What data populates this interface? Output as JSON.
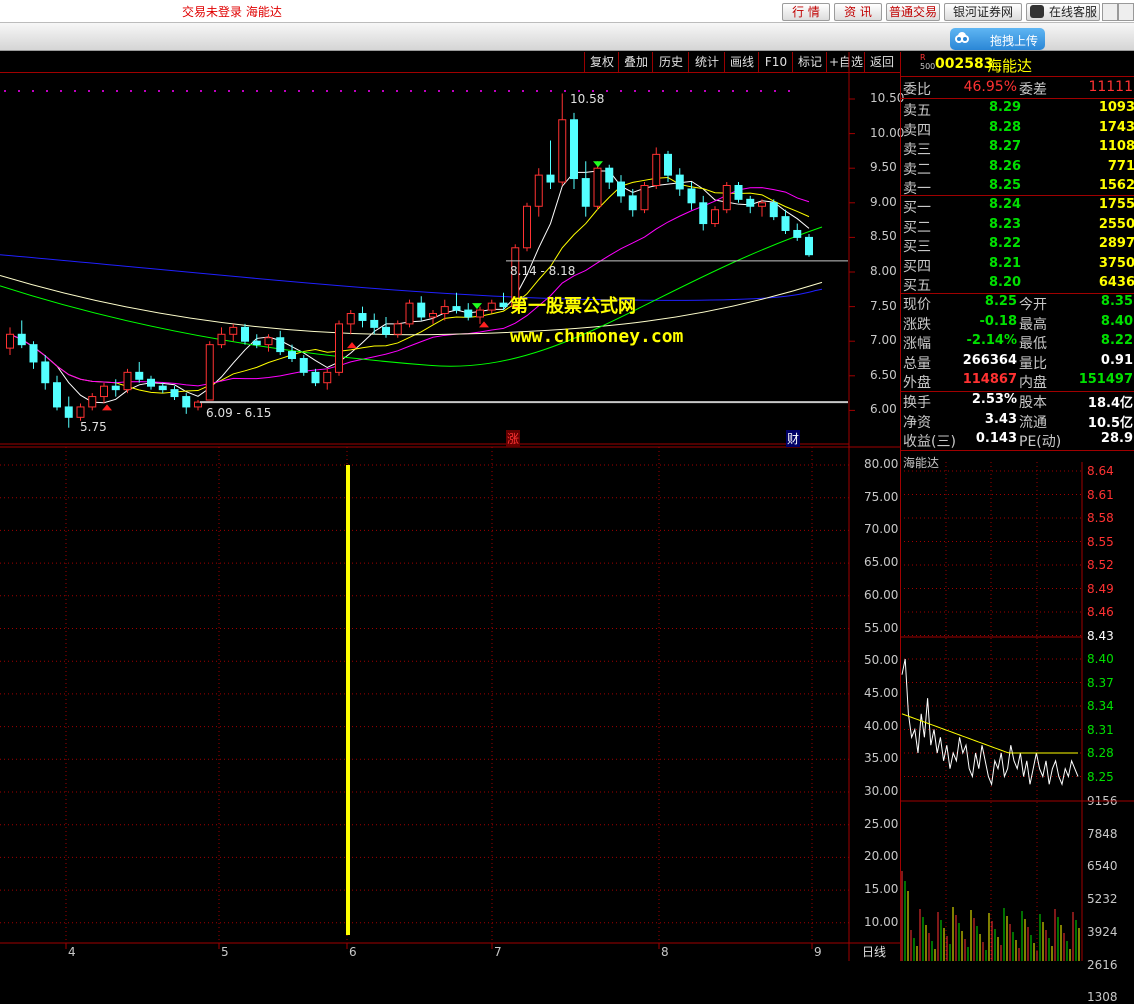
{
  "topbar": {
    "status": "交易未登录  海能达",
    "buttons": [
      "行 情",
      "资 讯",
      "普通交易",
      "银河证券网",
      "在线客服"
    ]
  },
  "toolbar": {
    "upload_label": "拖拽上传"
  },
  "menu": [
    "复权",
    "叠加",
    "历史",
    "统计",
    "画线",
    "F10",
    "标记",
    "+自选",
    "返回"
  ],
  "kline": {
    "price_axis": [
      "10.50",
      "10.00",
      "9.50",
      "9.00",
      "8.50",
      "8.00",
      "7.50",
      "7.00",
      "6.50",
      "6.00"
    ],
    "annotations": {
      "high": "10.58",
      "low": "5.75",
      "gap1": "6.09 - 6.15",
      "gap2": "8.14 - 8.18",
      "zhang": "涨",
      "cai": "财"
    }
  },
  "indicator": {
    "axis": [
      "80.00",
      "75.00",
      "70.00",
      "65.00",
      "60.00",
      "55.00",
      "50.00",
      "45.00",
      "40.00",
      "35.00",
      "30.00",
      "25.00",
      "20.00",
      "15.00",
      "10.00"
    ]
  },
  "x_axis": {
    "ticks": [
      "4",
      "5",
      "6",
      "7",
      "8",
      "9"
    ],
    "period": "日线"
  },
  "watermark": {
    "cn": "第一股票公式网",
    "url": "www.chnmoney.com"
  },
  "quote": {
    "r_badge": "R",
    "r_badge_sub": "500",
    "code": "002583",
    "name": "海能达",
    "weibi_label": "委比",
    "weibi": "46.95%",
    "weicha_label": "委差",
    "weicha": "11111",
    "asks": [
      {
        "label": "卖五",
        "price": "8.29",
        "vol": "1093"
      },
      {
        "label": "卖四",
        "price": "8.28",
        "vol": "1743"
      },
      {
        "label": "卖三",
        "price": "8.27",
        "vol": "1108"
      },
      {
        "label": "卖二",
        "price": "8.26",
        "vol": "771"
      },
      {
        "label": "卖一",
        "price": "8.25",
        "vol": "1562"
      }
    ],
    "bids": [
      {
        "label": "买一",
        "price": "8.24",
        "vol": "1755"
      },
      {
        "label": "买二",
        "price": "8.23",
        "vol": "2550"
      },
      {
        "label": "买三",
        "price": "8.22",
        "vol": "2897"
      },
      {
        "label": "买四",
        "price": "8.21",
        "vol": "3750"
      },
      {
        "label": "买五",
        "price": "8.20",
        "vol": "6436"
      }
    ],
    "stats": [
      {
        "l1": "现价",
        "v1": "8.25",
        "l2": "今开",
        "v2": "8.35"
      },
      {
        "l1": "涨跌",
        "v1": "-0.18",
        "l2": "最高",
        "v2": "8.40"
      },
      {
        "l1": "涨幅",
        "v1": "-2.14%",
        "l2": "最低",
        "v2": "8.22"
      },
      {
        "l1": "总量",
        "v1": "266364",
        "l2": "量比",
        "v2": "0.91"
      },
      {
        "l1": "外盘",
        "v1": "114867",
        "l2": "内盘",
        "v2": "151497"
      }
    ],
    "stats2": [
      {
        "l1": "换手",
        "v1": "2.53%",
        "l2": "股本",
        "v2": "18.4亿"
      },
      {
        "l1": "净资",
        "v1": "3.43",
        "l2": "流通",
        "v2": "10.5亿"
      },
      {
        "l1": "收益(三)",
        "v1": "0.143",
        "l2": "PE(动)",
        "v2": "28.9"
      }
    ]
  },
  "minute": {
    "title": "海能达",
    "price_axis": [
      "8.64",
      "8.61",
      "8.58",
      "8.55",
      "8.52",
      "8.49",
      "8.46",
      "8.43",
      "8.40",
      "8.37",
      "8.34",
      "8.31",
      "8.28",
      "8.25"
    ],
    "vol_axis": [
      "9156",
      "7848",
      "6540",
      "5232",
      "3924",
      "2616",
      "1308"
    ]
  },
  "colors": {
    "up": "#ff3232",
    "down": "#54ffff",
    "ma5": "#ffffff",
    "ma10": "#ffff00",
    "ma20": "#ff00ff",
    "ma60": "#00ff00",
    "ma120": "#2020ff",
    "ma250": "#ffffcc",
    "grid": "#a00000"
  },
  "chart_data": {
    "type": "candlestick",
    "x_ticks": [
      "4",
      "5",
      "6",
      "7",
      "8",
      "9"
    ],
    "ylim": [
      5.7,
      10.7
    ],
    "candles": [
      [
        6.9,
        7.2,
        6.8,
        7.1
      ],
      [
        7.1,
        7.3,
        6.9,
        6.95
      ],
      [
        6.95,
        7.0,
        6.6,
        6.7
      ],
      [
        6.7,
        6.8,
        6.3,
        6.4
      ],
      [
        6.4,
        6.5,
        6.0,
        6.05
      ],
      [
        6.05,
        6.2,
        5.75,
        5.9
      ],
      [
        5.9,
        6.1,
        5.85,
        6.05
      ],
      [
        6.05,
        6.25,
        6.0,
        6.2
      ],
      [
        6.2,
        6.4,
        6.1,
        6.35
      ],
      [
        6.35,
        6.45,
        6.2,
        6.3
      ],
      [
        6.3,
        6.6,
        6.25,
        6.55
      ],
      [
        6.55,
        6.7,
        6.4,
        6.45
      ],
      [
        6.45,
        6.5,
        6.3,
        6.35
      ],
      [
        6.35,
        6.4,
        6.25,
        6.3
      ],
      [
        6.3,
        6.35,
        6.15,
        6.2
      ],
      [
        6.2,
        6.25,
        5.95,
        6.05
      ],
      [
        6.05,
        6.15,
        6.0,
        6.12
      ],
      [
        6.15,
        7.0,
        6.15,
        6.95
      ],
      [
        6.95,
        7.2,
        6.9,
        7.1
      ],
      [
        7.1,
        7.25,
        7.0,
        7.2
      ],
      [
        7.2,
        7.25,
        6.95,
        7.0
      ],
      [
        7.0,
        7.1,
        6.9,
        6.95
      ],
      [
        6.95,
        7.1,
        6.85,
        7.05
      ],
      [
        7.05,
        7.15,
        6.8,
        6.85
      ],
      [
        6.85,
        6.95,
        6.7,
        6.75
      ],
      [
        6.75,
        6.8,
        6.5,
        6.55
      ],
      [
        6.55,
        6.6,
        6.35,
        6.4
      ],
      [
        6.4,
        6.6,
        6.3,
        6.55
      ],
      [
        6.55,
        7.3,
        6.5,
        7.25
      ],
      [
        7.25,
        7.45,
        7.1,
        7.4
      ],
      [
        7.4,
        7.5,
        7.2,
        7.3
      ],
      [
        7.3,
        7.4,
        7.1,
        7.2
      ],
      [
        7.2,
        7.35,
        7.05,
        7.1
      ],
      [
        7.1,
        7.3,
        7.05,
        7.25
      ],
      [
        7.25,
        7.6,
        7.2,
        7.55
      ],
      [
        7.55,
        7.65,
        7.3,
        7.35
      ],
      [
        7.35,
        7.45,
        7.25,
        7.4
      ],
      [
        7.4,
        7.6,
        7.3,
        7.5
      ],
      [
        7.5,
        7.7,
        7.4,
        7.45
      ],
      [
        7.45,
        7.55,
        7.3,
        7.35
      ],
      [
        7.35,
        7.5,
        7.25,
        7.45
      ],
      [
        7.45,
        7.6,
        7.4,
        7.55
      ],
      [
        7.55,
        7.7,
        7.45,
        7.5
      ],
      [
        7.5,
        8.4,
        7.5,
        8.35
      ],
      [
        8.35,
        9.0,
        8.3,
        8.95
      ],
      [
        8.95,
        9.5,
        8.8,
        9.4
      ],
      [
        9.4,
        9.9,
        9.2,
        9.3
      ],
      [
        9.3,
        10.58,
        9.25,
        10.2
      ],
      [
        10.2,
        10.3,
        9.2,
        9.35
      ],
      [
        9.35,
        9.6,
        8.8,
        8.95
      ],
      [
        8.95,
        9.6,
        8.9,
        9.5
      ],
      [
        9.5,
        9.55,
        9.2,
        9.3
      ],
      [
        9.3,
        9.4,
        9.0,
        9.1
      ],
      [
        9.1,
        9.2,
        8.8,
        8.9
      ],
      [
        8.9,
        9.3,
        8.85,
        9.25
      ],
      [
        9.25,
        9.8,
        9.2,
        9.7
      ],
      [
        9.7,
        9.75,
        9.3,
        9.4
      ],
      [
        9.4,
        9.5,
        9.1,
        9.2
      ],
      [
        9.2,
        9.3,
        8.9,
        9.0
      ],
      [
        9.0,
        9.1,
        8.6,
        8.7
      ],
      [
        8.7,
        8.95,
        8.65,
        8.9
      ],
      [
        8.9,
        9.3,
        8.85,
        9.25
      ],
      [
        9.25,
        9.3,
        9.0,
        9.05
      ],
      [
        9.05,
        9.1,
        8.85,
        8.95
      ],
      [
        8.95,
        9.05,
        8.8,
        9.0
      ],
      [
        9.0,
        9.05,
        8.75,
        8.8
      ],
      [
        8.8,
        8.9,
        8.55,
        8.6
      ],
      [
        8.6,
        8.7,
        8.45,
        8.5
      ],
      [
        8.5,
        8.55,
        8.22,
        8.25
      ]
    ]
  }
}
